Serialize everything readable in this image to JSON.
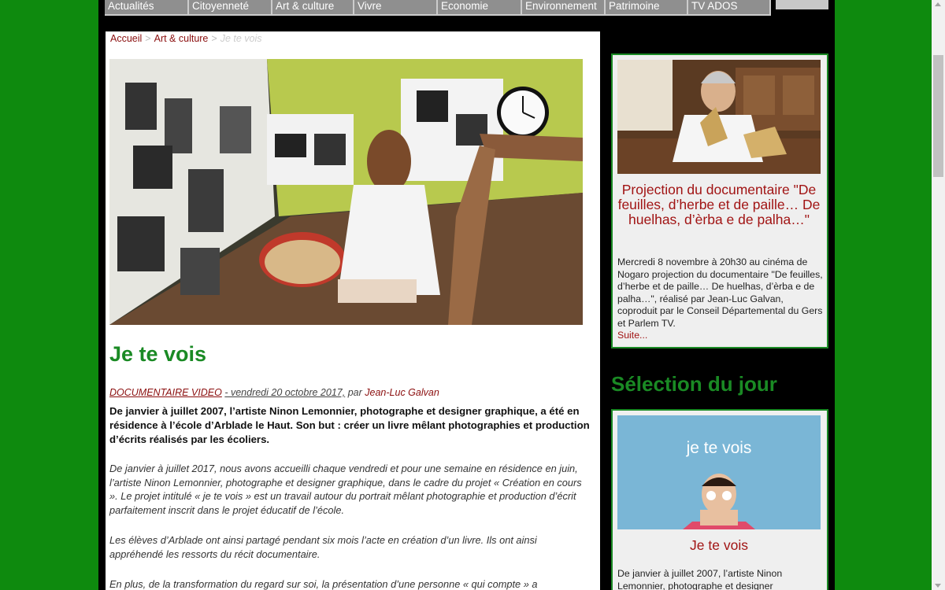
{
  "nav": {
    "items": [
      {
        "label": "Actualités"
      },
      {
        "label": "Citoyenneté"
      },
      {
        "label": "Art & culture"
      },
      {
        "label": "Vivre"
      },
      {
        "label": "Economie"
      },
      {
        "label": "Environnement"
      },
      {
        "label": "Patrimoine"
      },
      {
        "label": "TV ADOS"
      }
    ]
  },
  "breadcrumb": {
    "home": "Accueil",
    "section": "Art & culture",
    "current": "Je te vois",
    "separator": ">"
  },
  "article": {
    "title": "Je te vois",
    "category": "DOCUMENTAIRE VIDEO",
    "date": "- vendredi 20 octobre 2017,",
    "by": "par",
    "author": "Jean-Luc Galvan",
    "lead": "De janvier à juillet 2007, l’artiste Ninon Lemonnier, photographe et designer graphique, a été en résidence à l’école d’Arblade le Haut. Son but : créer un livre mêlant photographies et production d’écrits réalisés par les écoliers.",
    "paragraphs": [
      "De janvier à juillet 2017, nous avons accueilli chaque vendredi et pour une semaine en résidence en juin, l’artiste Ninon Lemonnier, photographe et designer graphique, dans le cadre du projet « Création en cours ». Le projet intitulé « je te vois » est un travail autour du portrait mêlant photographie et production d’écrit parfaitement inscrit dans le projet éducatif de l’école.",
      "Les élèves d’Arblade ont ainsi partagé pendant six mois l’acte en création d’un livre. Ils ont ainsi appréhendé les ressorts du récit documentaire.",
      "En plus, de la transformation du regard sur soi, la présentation d’une personne « qui compte » a"
    ]
  },
  "sidebar": {
    "card1": {
      "title": "Projection du documentaire \"De feuilles, d’herbe et de paille… De huelhas, d’èrba e de palha…\"",
      "text": "Mercredi 8 novembre à 20h30 au cinéma de Nogaro projection du documentaire \"De feuilles, d’herbe et de paille… De huelhas, d’èrba e de palha…\", réalisé par Jean-Luc Galvan, coproduit par le Conseil Départemental du Gers et Parlem TV.",
      "more": "Suite..."
    },
    "section_title": "Sélection du jour",
    "card2": {
      "image_caption": "je te vois",
      "title": "Je te vois",
      "text": "De janvier à juillet 2007, l’artiste Ninon Lemonnier, photographe et designer"
    }
  },
  "colors": {
    "page_background": "#0e8a0e",
    "title_green": "#1a8a24",
    "link_red": "#8b0f0f",
    "nav_gray": "#8f8f8f"
  }
}
